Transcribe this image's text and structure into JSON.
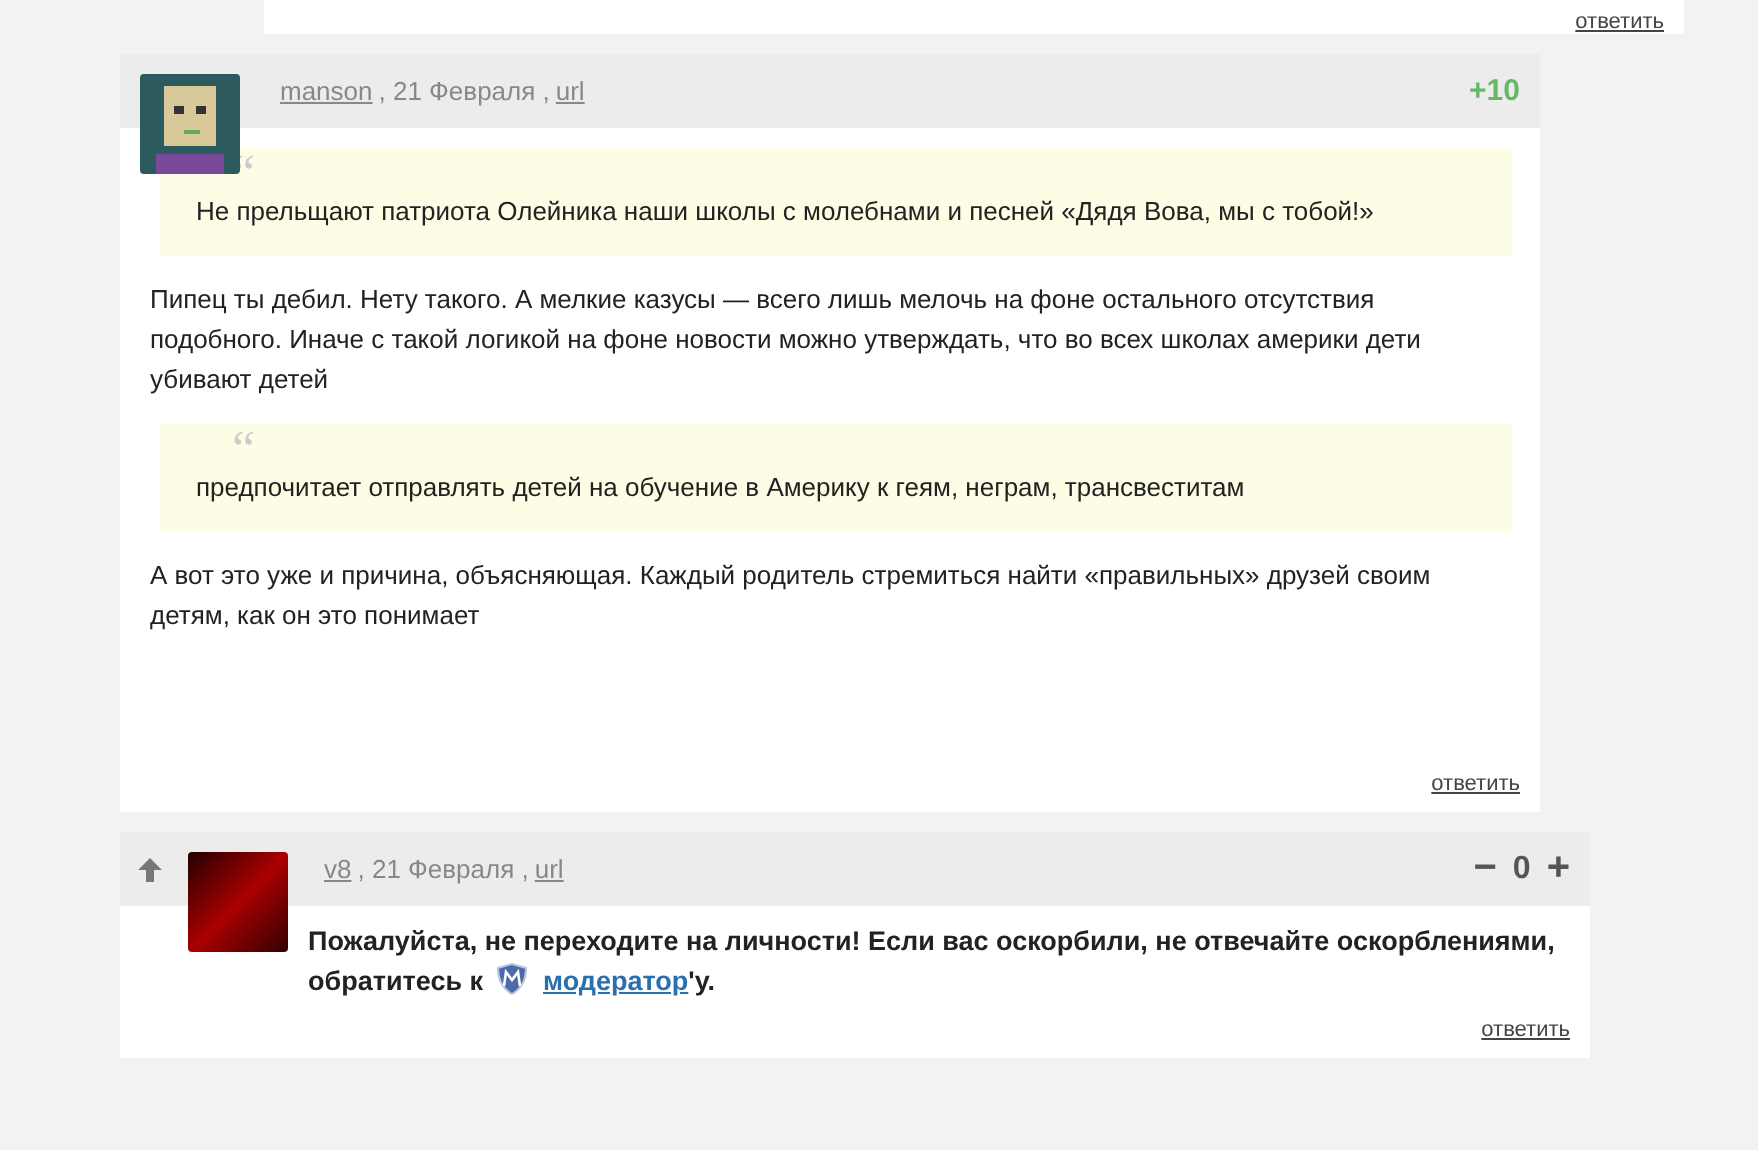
{
  "top_card": {
    "reply": "ответить"
  },
  "comments": [
    {
      "author": "manson",
      "date": ", 21 Февраля ,",
      "url": "url",
      "score": {
        "kind": "total",
        "value": "+10"
      },
      "blocks": [
        {
          "kind": "quote",
          "mark": "“",
          "text": "Не прельщают патриота Олейника наши школы с молебнами и песней «Дядя Вова, мы с тобой!»"
        },
        {
          "kind": "text",
          "text": "Пипец ты дебил. Нету такого. А мелкие казусы — всего лишь мелочь на фоне остального отсутствия подобного. Иначе с такой логикой на фоне новости можно утверждать, что во всех школах америки дети убивают детей"
        },
        {
          "kind": "quote",
          "mark": "“",
          "text": "предпочитает отправлять детей на обучение в Америку к геям, неграм, трансвеститам"
        },
        {
          "kind": "text",
          "text": "А вот это уже и причина, объясняющая. Каждый родитель стремиться найти «правильных» друзей своим детям, как он это понимает"
        }
      ],
      "reply": "ответить"
    },
    {
      "author": "v8",
      "date": ", 21 Февраля ,",
      "url": "url",
      "score": {
        "kind": "vote",
        "minus": "−",
        "value": "0",
        "plus": "+"
      },
      "blocks": [
        {
          "kind": "notice",
          "before": "Пожалуйста, не переходите на личности! Если вас оскорбили, не отвечайте оскорблениями, обратитесь к",
          "link": "модератор",
          "after": "'у."
        }
      ],
      "reply": "ответить"
    }
  ]
}
